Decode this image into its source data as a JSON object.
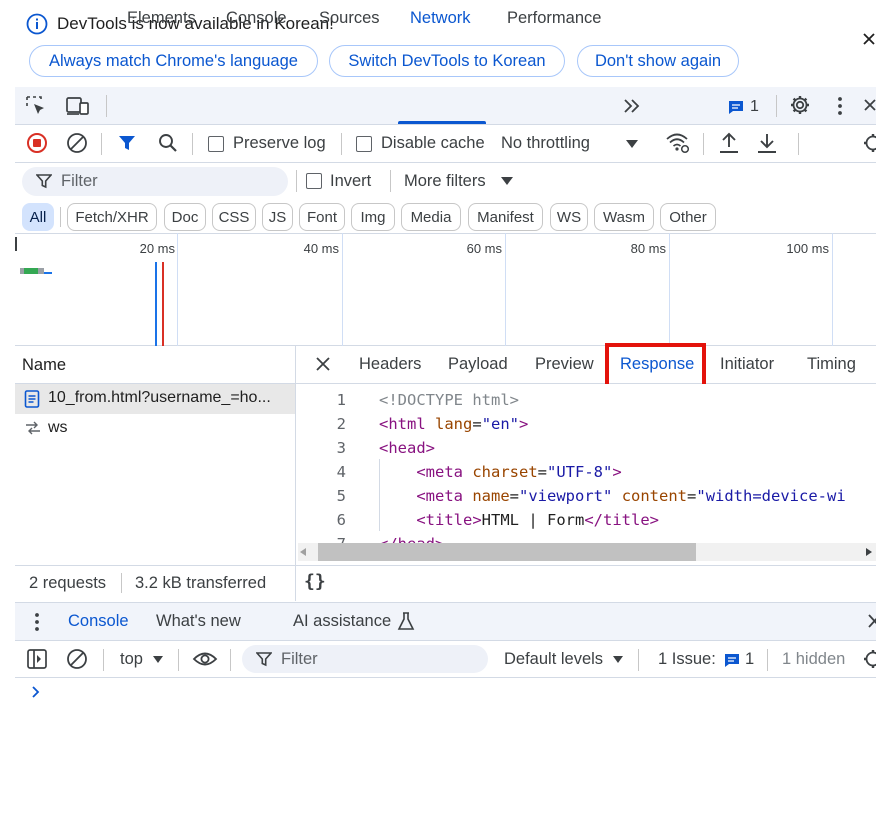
{
  "infobar": {
    "message": "DevTools is now available in Korean!",
    "buttons": [
      "Always match Chrome's language",
      "Switch DevTools to Korean",
      "Don't show again"
    ]
  },
  "main_tabs": {
    "items": [
      "Elements",
      "Console",
      "Sources",
      "Network",
      "Performance"
    ],
    "active": "Network",
    "issues_count": "1"
  },
  "toolbar": {
    "preserve_log": "Preserve log",
    "disable_cache": "Disable cache",
    "throttling": "No throttling"
  },
  "filter_row": {
    "filter_placeholder": "Filter",
    "invert": "Invert",
    "more_filters": "More filters"
  },
  "type_filters": [
    "All",
    "Fetch/XHR",
    "Doc",
    "CSS",
    "JS",
    "Font",
    "Img",
    "Media",
    "Manifest",
    "WS",
    "Wasm",
    "Other"
  ],
  "overview": {
    "ticks": [
      "20 ms",
      "40 ms",
      "60 ms",
      "80 ms",
      "100 ms"
    ]
  },
  "requests": {
    "header": "Name",
    "rows": [
      {
        "name": "10_from.html?username_=ho...",
        "icon": "document-icon"
      },
      {
        "name": "ws",
        "icon": "websocket-icon"
      }
    ]
  },
  "detail_tabs": {
    "items": [
      "Headers",
      "Payload",
      "Preview",
      "Response",
      "Initiator",
      "Timing"
    ],
    "active": "Response"
  },
  "response": {
    "line_numbers": [
      "1",
      "2",
      "3",
      "4",
      "5",
      "6",
      "7"
    ],
    "lines": [
      "<!DOCTYPE html>",
      "<html lang=\"en\">",
      "<head>",
      "    <meta charset=\"UTF-8\">",
      "    <meta name=\"viewport\" content=\"width=device-wi",
      "    <title>HTML | Form</title>",
      "</head>"
    ]
  },
  "status": {
    "requests": "2 requests",
    "transferred": "3.2 kB transferred",
    "pretty_print": "{}"
  },
  "drawer": {
    "tabs": [
      "Console",
      "What's new",
      "AI assistance"
    ],
    "active": "Console"
  },
  "console_toolbar": {
    "context": "top",
    "filter_placeholder": "Filter",
    "levels": "Default levels",
    "issues_label": "1 Issue:",
    "issues_count": "1",
    "hidden": "1 hidden"
  },
  "colors": {
    "accent": "#0b57d0",
    "highlight": "#e3120b",
    "record": "#d93025"
  }
}
